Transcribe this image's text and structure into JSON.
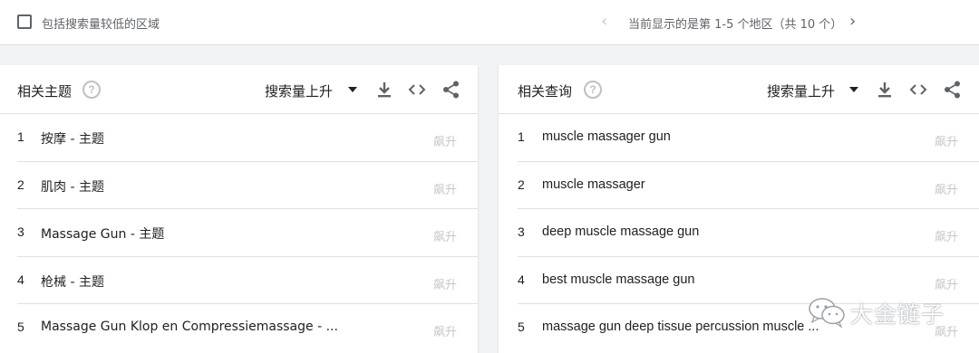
{
  "topbar": {
    "checkbox_label": "包括搜索量较低的区域",
    "pager_text": "当前显示的是第 1-5 个地区（共 10 个）",
    "prev_icon": "chevron-left-icon",
    "next_icon": "chevron-right-icon"
  },
  "topics": {
    "title": "相关主题",
    "sort_label": "搜索量上升",
    "rows": [
      {
        "num": "1",
        "text": "按摩 - 主题",
        "badge": "飙升"
      },
      {
        "num": "2",
        "text": "肌肉 - 主题",
        "badge": "飙升"
      },
      {
        "num": "3",
        "text": "Massage Gun - 主题",
        "badge": "飙升"
      },
      {
        "num": "4",
        "text": "枪械 - 主题",
        "badge": "飙升"
      },
      {
        "num": "5",
        "text": "Massage Gun Klop en Compressiemassage - ...",
        "badge": "飙升"
      }
    ]
  },
  "queries": {
    "title": "相关查询",
    "sort_label": "搜索量上升",
    "rows": [
      {
        "num": "1",
        "text": "muscle massager gun",
        "badge": "飙升"
      },
      {
        "num": "2",
        "text": "muscle massager",
        "badge": "飙升"
      },
      {
        "num": "3",
        "text": "deep muscle massage gun",
        "badge": "飙升"
      },
      {
        "num": "4",
        "text": "best muscle massage gun",
        "badge": "飙升"
      },
      {
        "num": "5",
        "text": "massage gun deep tissue percussion muscle ...",
        "badge": "飙升"
      }
    ]
  },
  "watermark": {
    "text": "大金链子",
    "icon": "wechat-icon"
  },
  "colors": {
    "text": "#202124",
    "muted": "#5f6368",
    "badge": "#c4c7c9",
    "divider": "#e0e0e0"
  }
}
